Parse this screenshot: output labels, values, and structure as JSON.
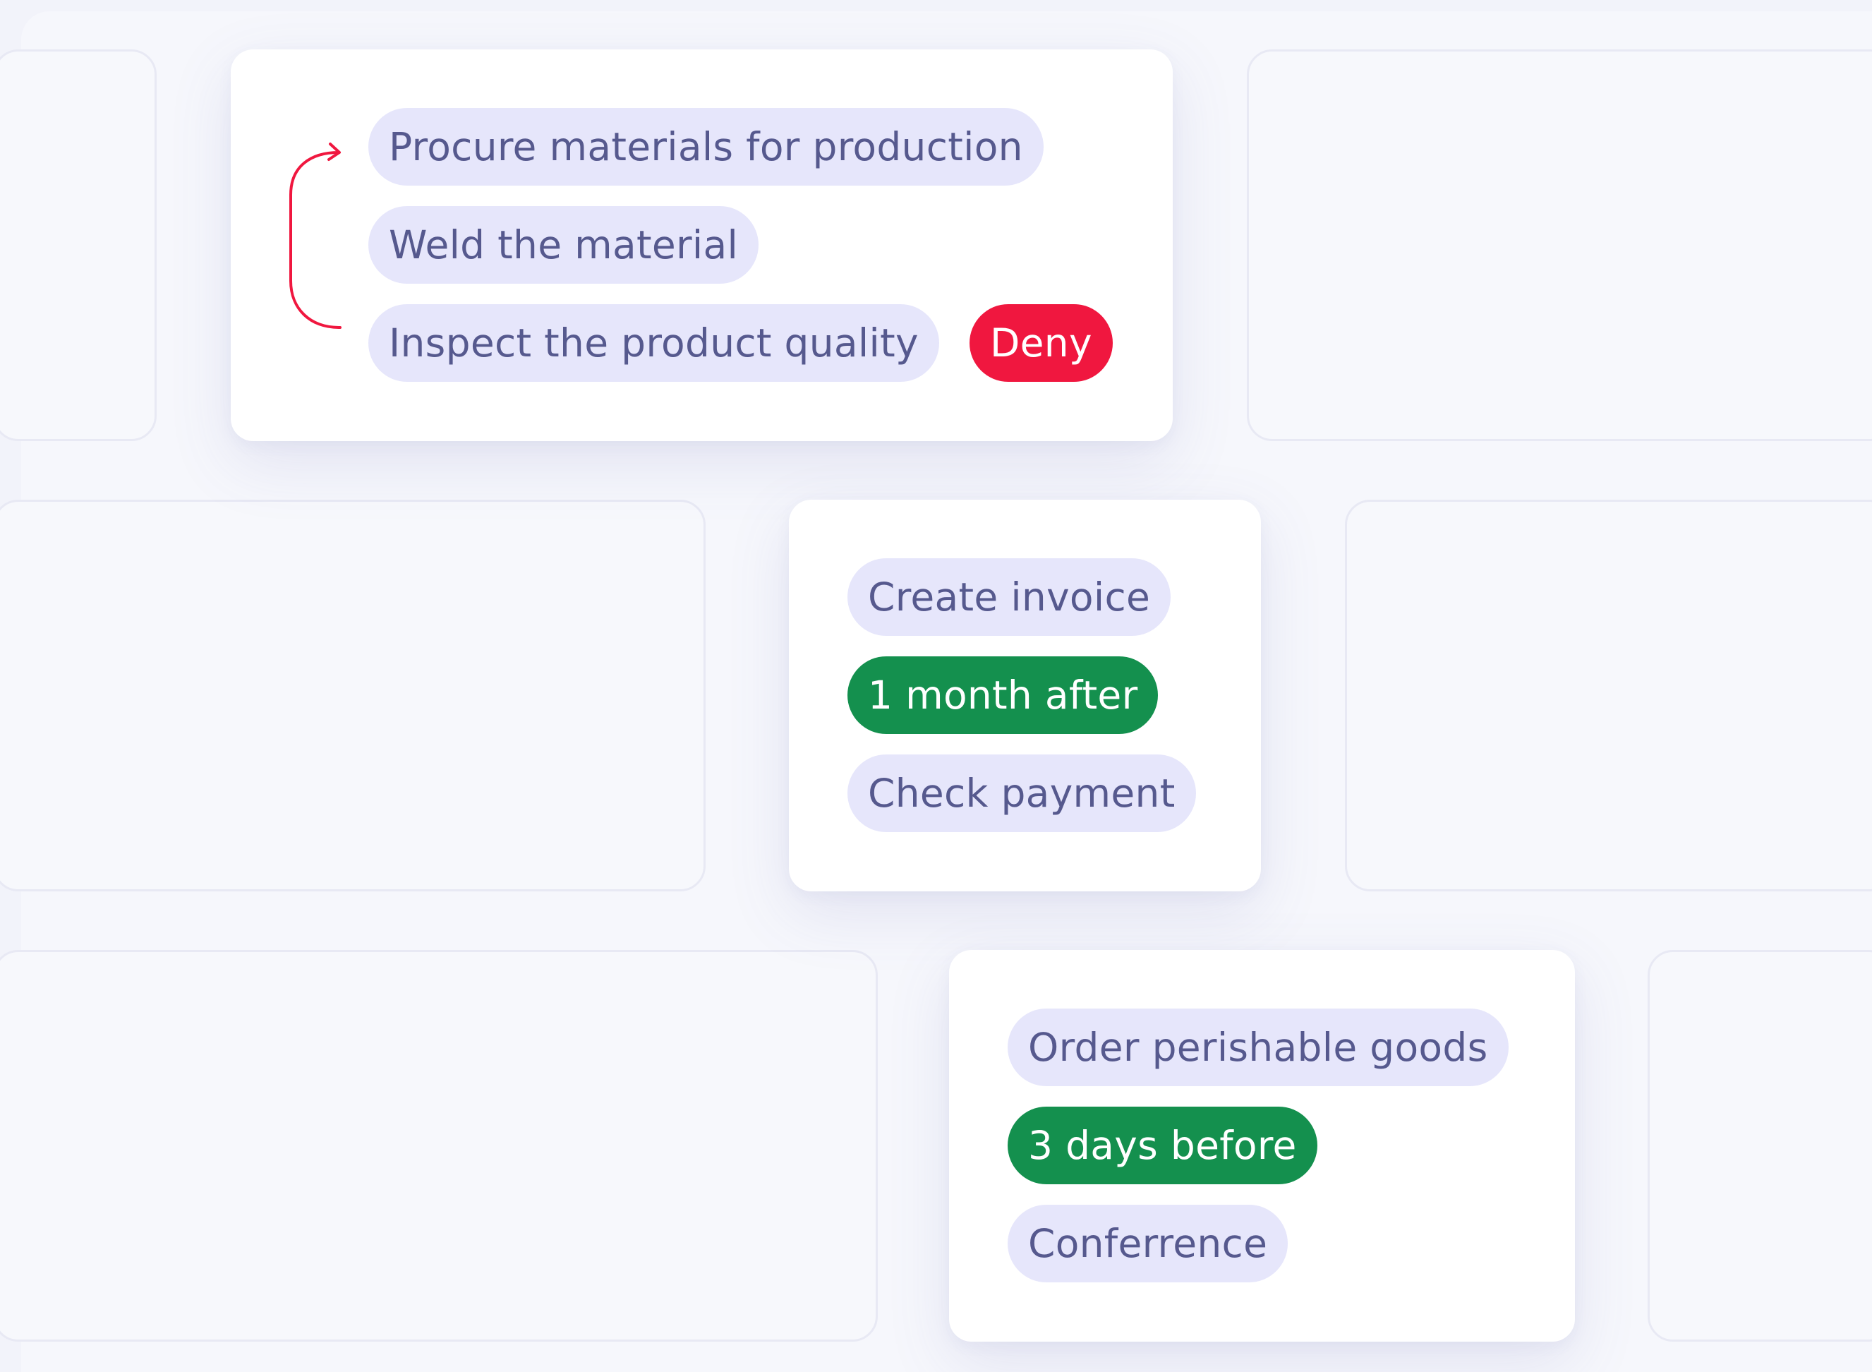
{
  "colors": {
    "background": "#f2f3fa",
    "card": "#ffffff",
    "task_pill": "#e6e6fb",
    "task_text": "#56598e",
    "positive": "#14904e",
    "negative": "#f0173f"
  },
  "cards": [
    {
      "tasks": [
        "Procure materials for production",
        "Weld the material",
        "Inspect the product quality"
      ],
      "decision": "Deny",
      "loop_icon": "return-arrow-icon"
    },
    {
      "tasks": [
        "Create invoice",
        "Check payment"
      ],
      "delay": "1 month after"
    },
    {
      "tasks": [
        "Order perishable goods",
        "Conferrence"
      ],
      "delay": "3 days before"
    }
  ]
}
